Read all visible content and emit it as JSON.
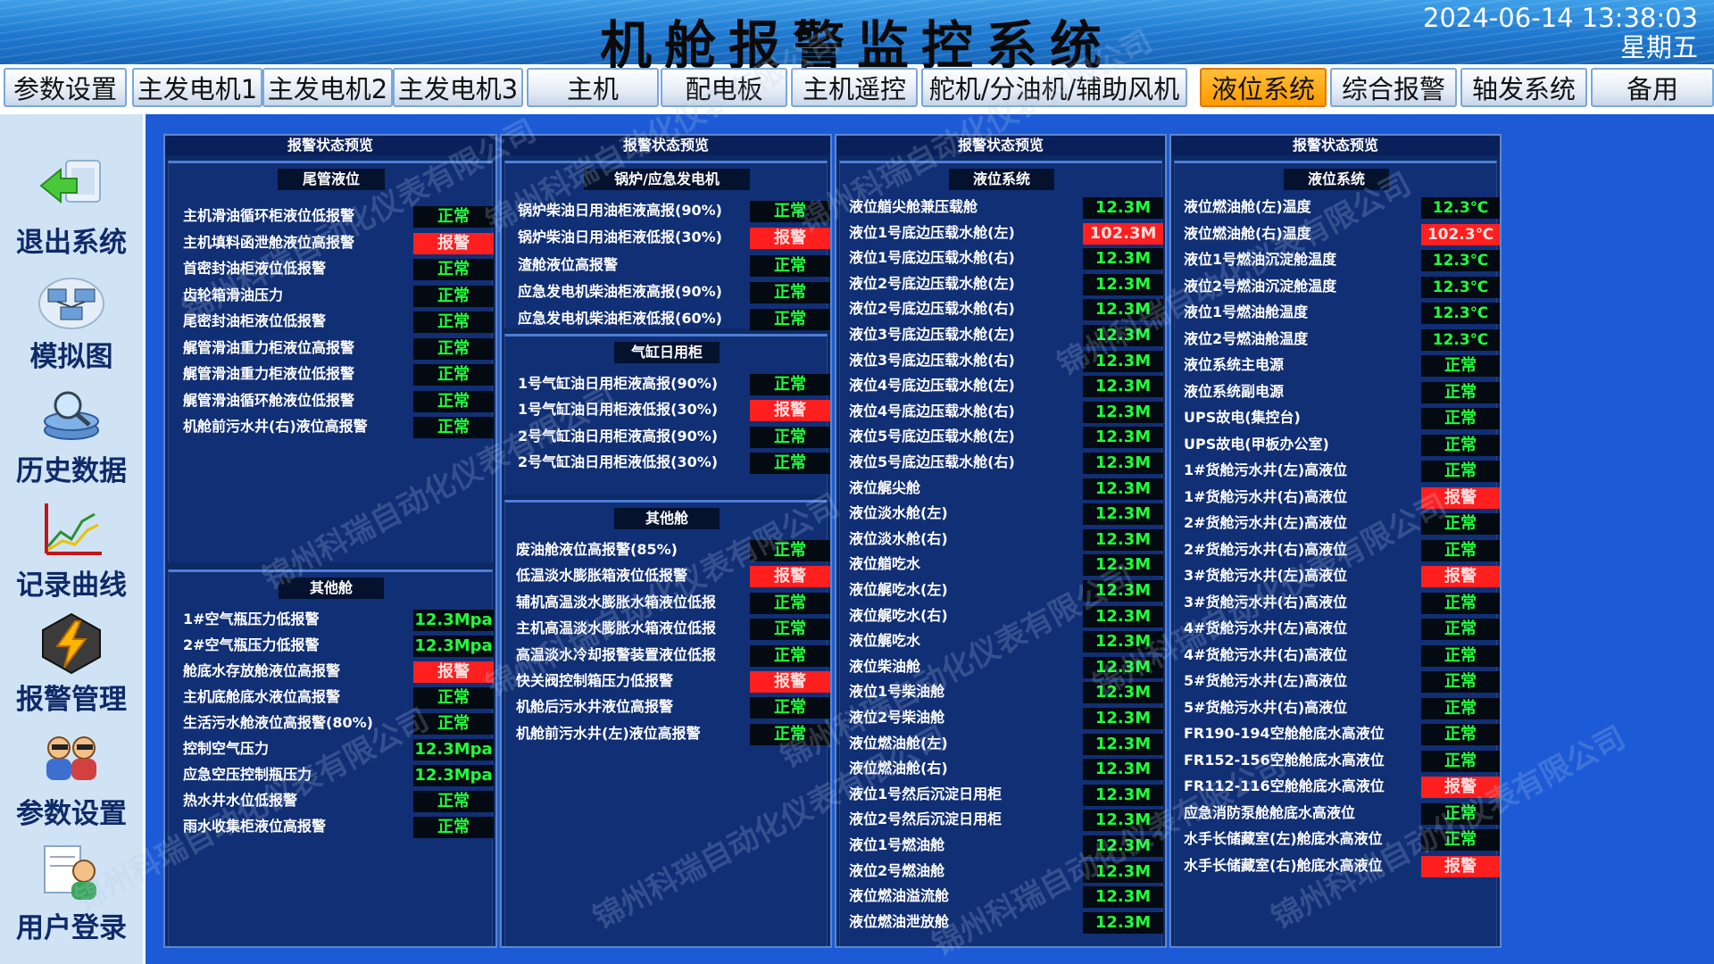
{
  "header": {
    "title": "机舱报警监控系统",
    "date": "2024-06-14 13:38:03",
    "weekday": "星期五"
  },
  "tabs": [
    "参数设置",
    "主发电机1",
    "主发电机2",
    "主发电机3",
    "主机",
    "配电板",
    "主机遥控",
    "舵机/分油机/辅助风机",
    "液位系统",
    "综合报警",
    "轴发系统",
    "备用"
  ],
  "active_tab": "液位系统",
  "sidebar": [
    {
      "label": "退出系统",
      "icon": "exit-icon"
    },
    {
      "label": "模拟图",
      "icon": "schematic-icon"
    },
    {
      "label": "历史数据",
      "icon": "history-icon"
    },
    {
      "label": "记录曲线",
      "icon": "chart-icon"
    },
    {
      "label": "报警管理",
      "icon": "alarm-icon"
    },
    {
      "label": "参数设置",
      "icon": "settings-users-icon"
    },
    {
      "label": "用户登录",
      "icon": "user-login-icon"
    }
  ],
  "watermark": "锦州科瑞自动化仪表有限公司",
  "panels": [
    {
      "head": "报警状态预览",
      "sections": [
        {
          "title": "尾管液位",
          "rows": [
            {
              "label": "主机滑油循环柜液位低报警",
              "value": "正常",
              "status": "ok"
            },
            {
              "label": "主机填料函泄舱液位高报警",
              "value": "报警",
              "status": "alarm"
            },
            {
              "label": "首密封油柜液位低报警",
              "value": "正常",
              "status": "ok"
            },
            {
              "label": "齿轮箱滑油压力",
              "value": "正常",
              "status": "ok"
            },
            {
              "label": "尾密封油柜液位低报警",
              "value": "正常",
              "status": "ok"
            },
            {
              "label": "艉管滑油重力柜液位高报警",
              "value": "正常",
              "status": "ok"
            },
            {
              "label": "艉管滑油重力柜液位低报警",
              "value": "正常",
              "status": "ok"
            },
            {
              "label": "艉管滑油循环舱液位低报警",
              "value": "正常",
              "status": "ok"
            },
            {
              "label": "机舱前污水井(右)液位高报警",
              "value": "正常",
              "status": "ok"
            }
          ]
        },
        {
          "title": "其他舱",
          "rows": [
            {
              "label": "1#空气瓶压力低报警",
              "value": "12.3Mpa",
              "status": "ok"
            },
            {
              "label": "2#空气瓶压力低报警",
              "value": "12.3Mpa",
              "status": "ok"
            },
            {
              "label": "舱底水存放舱液位高报警",
              "value": "报警",
              "status": "alarm"
            },
            {
              "label": "主机底舱底水液位高报警",
              "value": "正常",
              "status": "ok"
            },
            {
              "label": "生活污水舱液位高报警(80%)",
              "value": "正常",
              "status": "ok"
            },
            {
              "label": "控制空气压力",
              "value": "12.3Mpa",
              "status": "ok"
            },
            {
              "label": "应急空压控制瓶压力",
              "value": "12.3Mpa",
              "status": "ok"
            },
            {
              "label": "热水井水位低报警",
              "value": "正常",
              "status": "ok"
            },
            {
              "label": "雨水收集柜液位高报警",
              "value": "正常",
              "status": "ok"
            }
          ]
        }
      ]
    },
    {
      "head": "报警状态预览",
      "sections": [
        {
          "title": "锅炉/应急发电机",
          "rows": [
            {
              "label": "锅炉柴油日用油柜液高报(90%)",
              "value": "正常",
              "status": "ok"
            },
            {
              "label": "锅炉柴油日用油柜液低报(30%)",
              "value": "报警",
              "status": "alarm"
            },
            {
              "label": "渣舱液位高报警",
              "value": "正常",
              "status": "ok"
            },
            {
              "label": "应急发电机柴油柜液高报(90%)",
              "value": "正常",
              "status": "ok"
            },
            {
              "label": "应急发电机柴油柜液低报(60%)",
              "value": "正常",
              "status": "ok"
            }
          ]
        },
        {
          "title": "气缸日用柜",
          "rows": [
            {
              "label": "1号气缸油日用柜液高报(90%)",
              "value": "正常",
              "status": "ok"
            },
            {
              "label": "1号气缸油日用柜液低报(30%)",
              "value": "报警",
              "status": "alarm"
            },
            {
              "label": "2号气缸油日用柜液高报(90%)",
              "value": "正常",
              "status": "ok"
            },
            {
              "label": "2号气缸油日用柜液低报(30%)",
              "value": "正常",
              "status": "ok"
            }
          ]
        },
        {
          "title": "其他舱",
          "rows": [
            {
              "label": "废油舱液位高报警(85%)",
              "value": "正常",
              "status": "ok"
            },
            {
              "label": "低温淡水膨胀箱液位低报警",
              "value": "报警",
              "status": "alarm"
            },
            {
              "label": "辅机高温淡水膨胀水箱液位低报",
              "value": "正常",
              "status": "ok"
            },
            {
              "label": "主机高温淡水膨胀水箱液位低报",
              "value": "正常",
              "status": "ok"
            },
            {
              "label": "高温淡水冷却报警装置液位低报",
              "value": "正常",
              "status": "ok"
            },
            {
              "label": "快关阀控制箱压力低报警",
              "value": "报警",
              "status": "alarm"
            },
            {
              "label": "机舱后污水井液位高报警",
              "value": "正常",
              "status": "ok"
            },
            {
              "label": "机舱前污水井(左)液位高报警",
              "value": "正常",
              "status": "ok"
            }
          ]
        }
      ]
    },
    {
      "head": "报警状态预览",
      "sections": [
        {
          "title": "液位系统",
          "rows": [
            {
              "label": "液位艏尖舱兼压载舱",
              "value": "12.3M",
              "status": "ok"
            },
            {
              "label": "液位1号底边压载水舱(左)",
              "value": "102.3M",
              "status": "alarm"
            },
            {
              "label": "液位1号底边压载水舱(右)",
              "value": "12.3M",
              "status": "ok"
            },
            {
              "label": "液位2号底边压载水舱(左)",
              "value": "12.3M",
              "status": "ok"
            },
            {
              "label": "液位2号底边压载水舱(右)",
              "value": "12.3M",
              "status": "ok"
            },
            {
              "label": "液位3号底边压载水舱(左)",
              "value": "12.3M",
              "status": "ok"
            },
            {
              "label": "液位3号底边压载水舱(右)",
              "value": "12.3M",
              "status": "ok"
            },
            {
              "label": "液位4号底边压载水舱(左)",
              "value": "12.3M",
              "status": "ok"
            },
            {
              "label": "液位4号底边压载水舱(右)",
              "value": "12.3M",
              "status": "ok"
            },
            {
              "label": "液位5号底边压载水舱(左)",
              "value": "12.3M",
              "status": "ok"
            },
            {
              "label": "液位5号底边压载水舱(右)",
              "value": "12.3M",
              "status": "ok"
            },
            {
              "label": "液位艉尖舱",
              "value": "12.3M",
              "status": "ok"
            },
            {
              "label": "液位淡水舱(左)",
              "value": "12.3M",
              "status": "ok"
            },
            {
              "label": "液位淡水舱(右)",
              "value": "12.3M",
              "status": "ok"
            },
            {
              "label": "液位艏吃水",
              "value": "12.3M",
              "status": "ok"
            },
            {
              "label": "液位艉吃水(左)",
              "value": "12.3M",
              "status": "ok"
            },
            {
              "label": "液位艉吃水(右)",
              "value": "12.3M",
              "status": "ok"
            },
            {
              "label": "液位艉吃水",
              "value": "12.3M",
              "status": "ok"
            },
            {
              "label": "液位柴油舱",
              "value": "12.3M",
              "status": "ok"
            },
            {
              "label": "液位1号柴油舱",
              "value": "12.3M",
              "status": "ok"
            },
            {
              "label": "液位2号柴油舱",
              "value": "12.3M",
              "status": "ok"
            },
            {
              "label": "液位燃油舱(左)",
              "value": "12.3M",
              "status": "ok"
            },
            {
              "label": "液位燃油舱(右)",
              "value": "12.3M",
              "status": "ok"
            },
            {
              "label": "液位1号然后沉淀日用柜",
              "value": "12.3M",
              "status": "ok"
            },
            {
              "label": "液位2号然后沉淀日用柜",
              "value": "12.3M",
              "status": "ok"
            },
            {
              "label": "液位1号燃油舱",
              "value": "12.3M",
              "status": "ok"
            },
            {
              "label": "液位2号燃油舱",
              "value": "12.3M",
              "status": "ok"
            },
            {
              "label": "液位燃油溢流舱",
              "value": "12.3M",
              "status": "ok"
            },
            {
              "label": "液位燃油泄放舱",
              "value": "12.3M",
              "status": "ok"
            }
          ]
        }
      ]
    },
    {
      "head": "报警状态预览",
      "sections": [
        {
          "title": "液位系统",
          "rows": [
            {
              "label": "液位燃油舱(左)温度",
              "value": "12.3℃",
              "status": "ok"
            },
            {
              "label": "液位燃油舱(右)温度",
              "value": "102.3℃",
              "status": "alarm"
            },
            {
              "label": "液位1号燃油沉淀舱温度",
              "value": "12.3℃",
              "status": "ok"
            },
            {
              "label": "液位2号燃油沉淀舱温度",
              "value": "12.3℃",
              "status": "ok"
            },
            {
              "label": "液位1号燃油舱温度",
              "value": "12.3℃",
              "status": "ok"
            },
            {
              "label": "液位2号燃油舱温度",
              "value": "12.3℃",
              "status": "ok"
            },
            {
              "label": "液位系统主电源",
              "value": "正常",
              "status": "ok"
            },
            {
              "label": "液位系统副电源",
              "value": "正常",
              "status": "ok"
            },
            {
              "label": "UPS故电(集控台)",
              "value": "正常",
              "status": "ok"
            },
            {
              "label": "UPS故电(甲板办公室)",
              "value": "正常",
              "status": "ok"
            },
            {
              "label": "1#货舱污水井(左)高液位",
              "value": "正常",
              "status": "ok"
            },
            {
              "label": "1#货舱污水井(右)高液位",
              "value": "报警",
              "status": "alarm"
            },
            {
              "label": "2#货舱污水井(左)高液位",
              "value": "正常",
              "status": "ok"
            },
            {
              "label": "2#货舱污水井(右)高液位",
              "value": "正常",
              "status": "ok"
            },
            {
              "label": "3#货舱污水井(左)高液位",
              "value": "报警",
              "status": "alarm"
            },
            {
              "label": "3#货舱污水井(右)高液位",
              "value": "正常",
              "status": "ok"
            },
            {
              "label": "4#货舱污水井(左)高液位",
              "value": "正常",
              "status": "ok"
            },
            {
              "label": "4#货舱污水井(右)高液位",
              "value": "正常",
              "status": "ok"
            },
            {
              "label": "5#货舱污水井(左)高液位",
              "value": "正常",
              "status": "ok"
            },
            {
              "label": "5#货舱污水井(右)高液位",
              "value": "正常",
              "status": "ok"
            },
            {
              "label": "FR190-194空舱舱底水高液位",
              "value": "正常",
              "status": "ok"
            },
            {
              "label": "FR152-156空舱舱底水高液位",
              "value": "正常",
              "status": "ok"
            },
            {
              "label": "FR112-116空舱舱底水高液位",
              "value": "报警",
              "status": "alarm"
            },
            {
              "label": "应急消防泵舱舱底水高液位",
              "value": "正常",
              "status": "ok"
            },
            {
              "label": "水手长储藏室(左)舱底水高液位",
              "value": "正常",
              "status": "ok"
            },
            {
              "label": "水手长储藏室(右)舱底水高液位",
              "value": "报警",
              "status": "alarm"
            }
          ]
        }
      ]
    }
  ]
}
